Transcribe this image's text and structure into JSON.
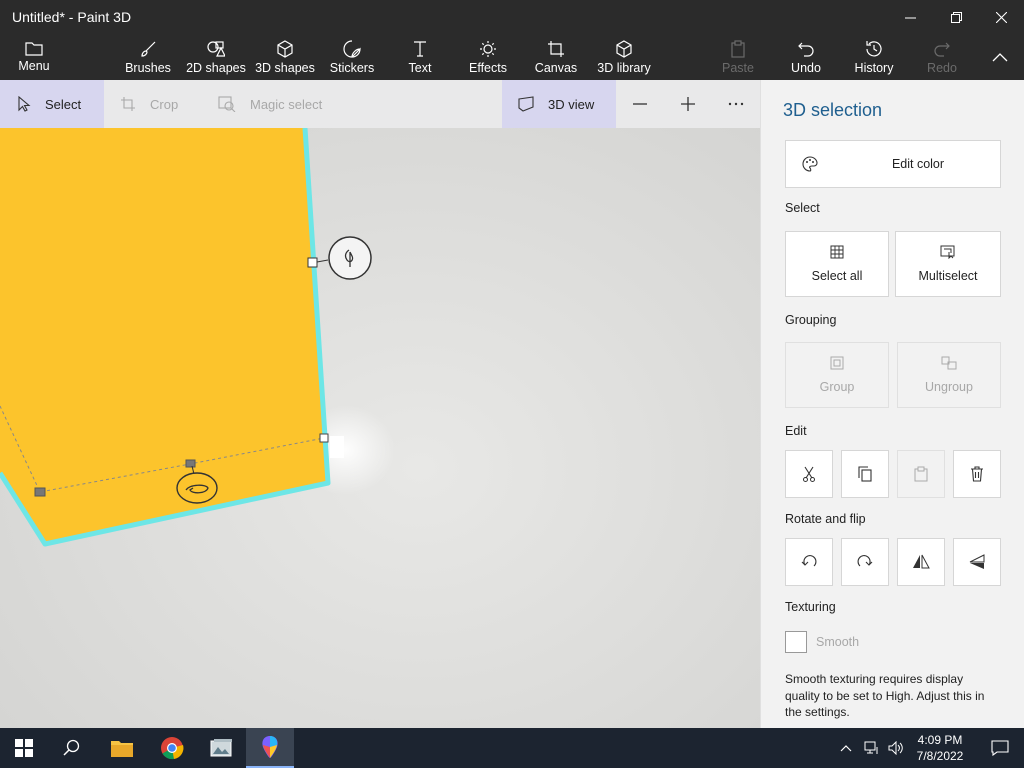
{
  "window": {
    "title": "Untitled* - Paint 3D"
  },
  "toolbar": {
    "menu": "Menu",
    "items": [
      "Brushes",
      "2D shapes",
      "3D shapes",
      "Stickers",
      "Text",
      "Effects",
      "Canvas",
      "3D library"
    ],
    "paste": "Paste",
    "undo": "Undo",
    "history": "History",
    "redo": "Redo"
  },
  "cmdbar": {
    "select": "Select",
    "crop": "Crop",
    "magic_select": "Magic select",
    "view3d": "3D view"
  },
  "panel": {
    "title": "3D selection",
    "edit_color": "Edit color",
    "select_section": "Select",
    "select_all": "Select all",
    "multiselect": "Multiselect",
    "grouping_section": "Grouping",
    "group": "Group",
    "ungroup": "Ungroup",
    "edit_section": "Edit",
    "rotate_section": "Rotate and flip",
    "texturing_section": "Texturing",
    "smooth": "Smooth",
    "smooth_note": "Smooth texturing requires display quality to be set to High. Adjust this in the settings."
  },
  "taskbar": {
    "time": "4:09 PM",
    "date": "7/8/2022"
  },
  "colors": {
    "shape_fill": "#fcc42c",
    "selection_outline": "#6de6e6",
    "accent": "#1f5f8f"
  }
}
